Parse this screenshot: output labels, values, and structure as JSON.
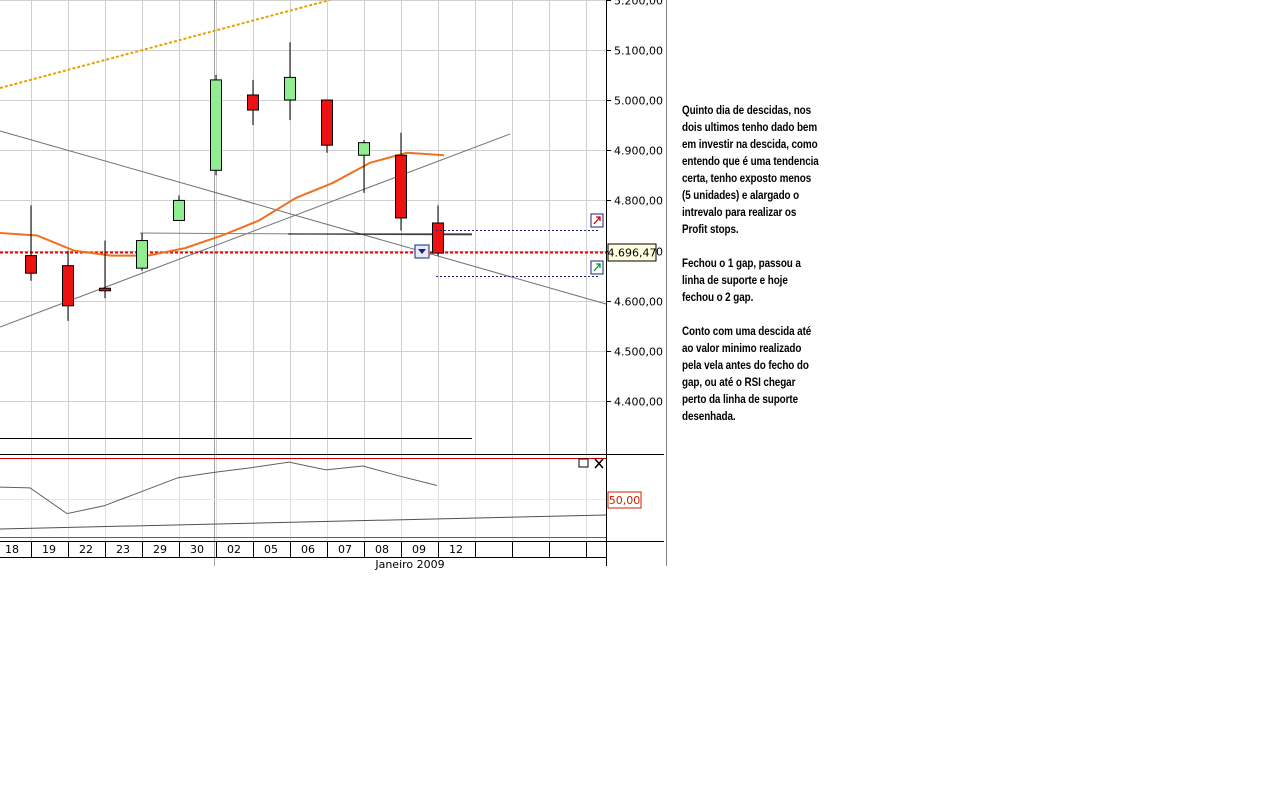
{
  "commentary": {
    "paragraph_1": "Quinto dia de descidas, nos dois ultimos tenho dado bem em investir na descida, como entendo que é uma tendencia certa, tenho exposto menos (5 unidades) e alargado o intrevalo para realizar os Profit stops.",
    "paragraph_2": "Fechou o 1 gap, passou a linha de suporte e hoje fechou o 2 gap.",
    "paragraph_3": "Conto com uma descida até ao valor minimo realizado pela vela antes do fecho do gap, ou até o RSI chegar perto da linha de suporte desenhada."
  },
  "chart_data": {
    "type": "candlestick",
    "x_tick_labels": [
      "18",
      "19",
      "22",
      "23",
      "29",
      "30",
      "02",
      "05",
      "06",
      "07",
      "08",
      "09",
      "12"
    ],
    "x_group_label": "Janeiro 2009",
    "y_tick_labels": [
      "5.200,00",
      "5.100,00",
      "5.000,00",
      "4.900,00",
      "4.800,00",
      "4.700,00",
      "4.600,00",
      "4.500,00",
      "4.400,00"
    ],
    "y_ticks": [
      5200,
      5100,
      5000,
      4900,
      4800,
      4700,
      4600,
      4500,
      4400
    ],
    "ylim": [
      4300,
      5200
    ],
    "current_price_label": "4.696,47",
    "current_price": 4696.47,
    "candles": [
      {
        "date": "18",
        "open": 4690,
        "high": 4790,
        "low": 4640,
        "close": 4655
      },
      {
        "date": "19",
        "open": 4670,
        "high": 4700,
        "low": 4560,
        "close": 4590
      },
      {
        "date": "22",
        "open": 4625,
        "high": 4720,
        "low": 4605,
        "close": 4620
      },
      {
        "date": "23",
        "open": 4665,
        "high": 4735,
        "low": 4660,
        "close": 4720
      },
      {
        "date": "29",
        "open": 4760,
        "high": 4810,
        "low": 4760,
        "close": 4800
      },
      {
        "date": "30",
        "open": 4860,
        "high": 5050,
        "low": 4850,
        "close": 5040
      },
      {
        "date": "02",
        "open": 5010,
        "high": 5040,
        "low": 4950,
        "close": 4980
      },
      {
        "date": "05",
        "open": 5000,
        "high": 5115,
        "low": 4960,
        "close": 5045
      },
      {
        "date": "06",
        "open": 5000,
        "high": 5000,
        "low": 4895,
        "close": 4910
      },
      {
        "date": "07",
        "open": 4890,
        "high": 4920,
        "low": 4815,
        "close": 4915
      },
      {
        "date": "08",
        "open": 4890,
        "high": 4935,
        "low": 4740,
        "close": 4765
      },
      {
        "date": "09",
        "open": 4755,
        "high": 4790,
        "low": 4690,
        "close": 4695
      }
    ],
    "moving_average": [
      4735,
      4730,
      4700,
      4690,
      4690,
      4705,
      4730,
      4760,
      4805,
      4835,
      4875,
      4895,
      4890
    ],
    "ma_color": "#f07020",
    "bull_color": "#90ee90",
    "bear_color": "#ee1111",
    "rsi": {
      "level_label": "50,00",
      "values": [
        64,
        63,
        30,
        40,
        58,
        76,
        83,
        89,
        96,
        86,
        91,
        78,
        66
      ]
    }
  },
  "colors": {
    "grid": "#d0d0d0",
    "price_line": "#ee0000",
    "trendline_orange": "#e8a000",
    "rsi_tag_border": "#cc2200"
  }
}
